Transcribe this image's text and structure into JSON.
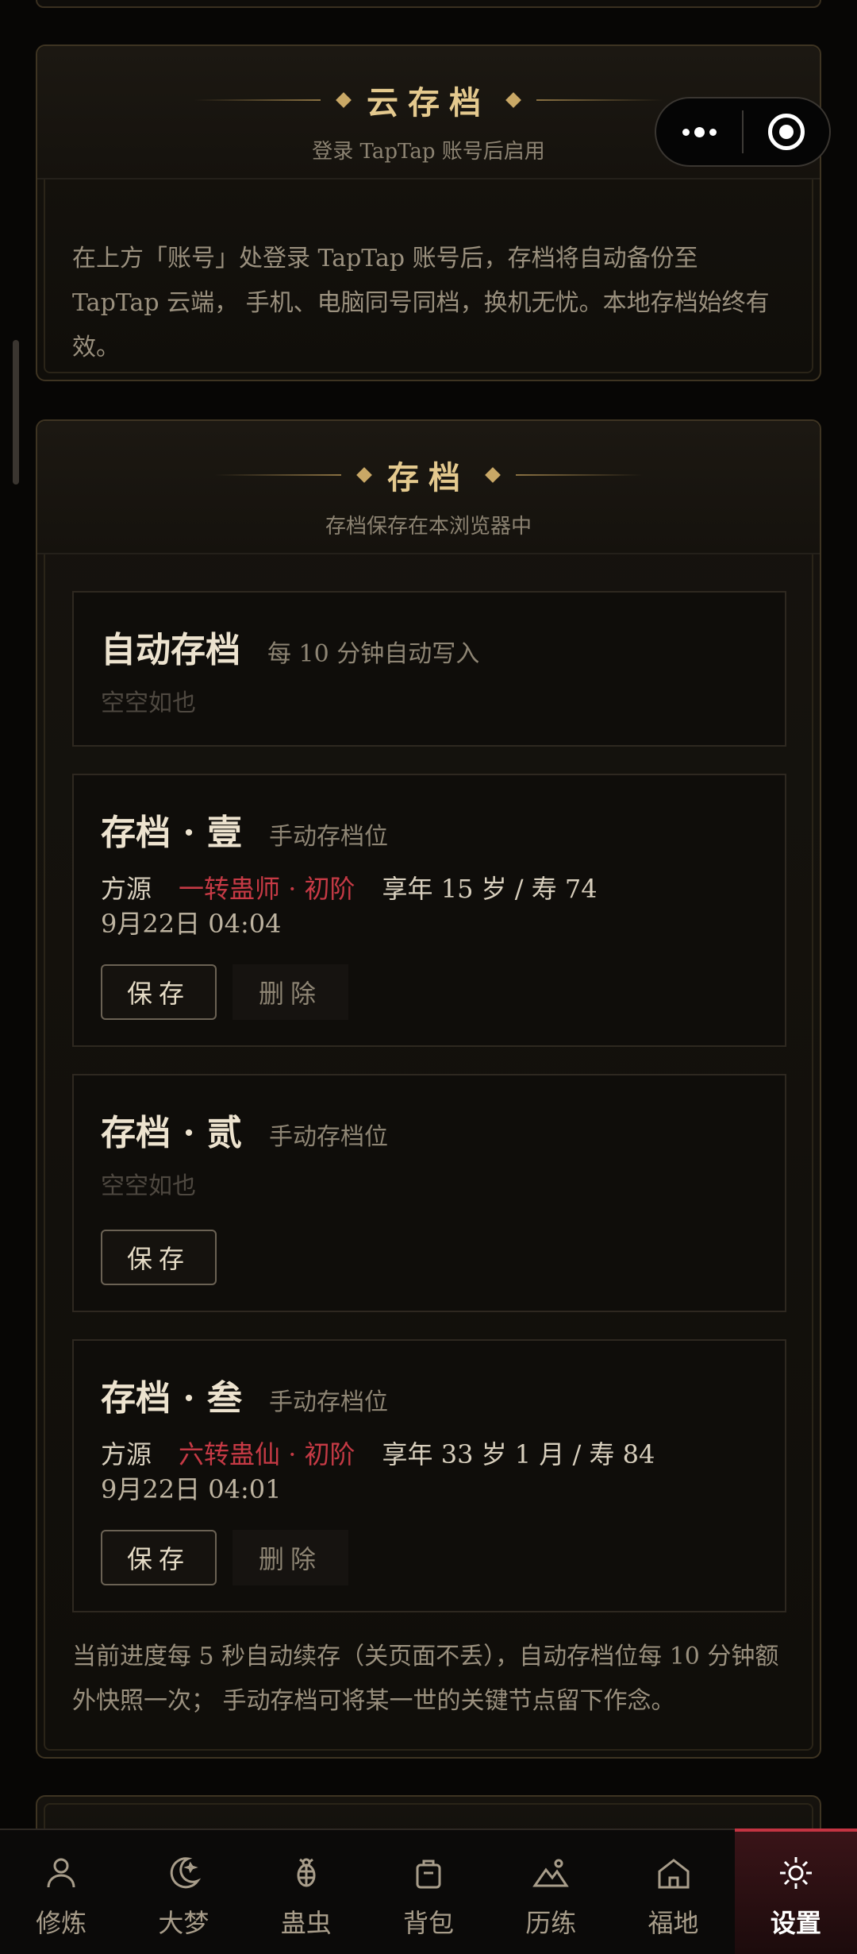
{
  "cloud": {
    "title": "云存档",
    "subtitle": "登录 TapTap 账号后启用",
    "desc_line1": "在上方「账号」处登录 TapTap 账号后，存档将自动备份至",
    "desc_line2": "TapTap 云端， 手机、电脑同号同档，换机无忧。本地存档始终有",
    "desc_line3": "效。"
  },
  "saves": {
    "title": "存档",
    "subtitle": "存档保存在本浏览器中",
    "auto": {
      "name": "自动存档",
      "hint": "每 10 分钟自动写入",
      "empty": "空空如也"
    },
    "slots": [
      {
        "name": "存档 · 壹",
        "hint": "手动存档位",
        "sect": "方源",
        "realm": "一转蛊师 · 初阶",
        "age": "享年 15 岁 / 寿 74",
        "date": "9月22日 04:04",
        "save_label": "保存",
        "delete_label": "删除"
      },
      {
        "name": "存档 · 贰",
        "hint": "手动存档位",
        "empty": "空空如也",
        "save_label": "保存"
      },
      {
        "name": "存档 · 叁",
        "hint": "手动存档位",
        "sect": "方源",
        "realm": "六转蛊仙 · 初阶",
        "age": "享年 33 岁 1 月 / 寿 84",
        "date": "9月22日 04:01",
        "save_label": "保存",
        "delete_label": "删除"
      }
    ],
    "footer_line1": "当前进度每 5 秒自动续存（关页面不丢），自动存档位每 10 分钟额",
    "footer_line2": "外快照一次； 手动存档可将某一世的关键节点留下作念。"
  },
  "tabs": [
    {
      "label": "修炼",
      "icon": "person-icon"
    },
    {
      "label": "大梦",
      "icon": "moon-icon"
    },
    {
      "label": "蛊虫",
      "icon": "bug-icon"
    },
    {
      "label": "背包",
      "icon": "bag-icon"
    },
    {
      "label": "历练",
      "icon": "mountain-icon"
    },
    {
      "label": "福地",
      "icon": "home-icon"
    },
    {
      "label": "设置",
      "icon": "gear-icon",
      "active": true
    }
  ],
  "colors": {
    "accent": "#c43442",
    "gold": "#e4c98e",
    "realm": "#c63a45"
  }
}
